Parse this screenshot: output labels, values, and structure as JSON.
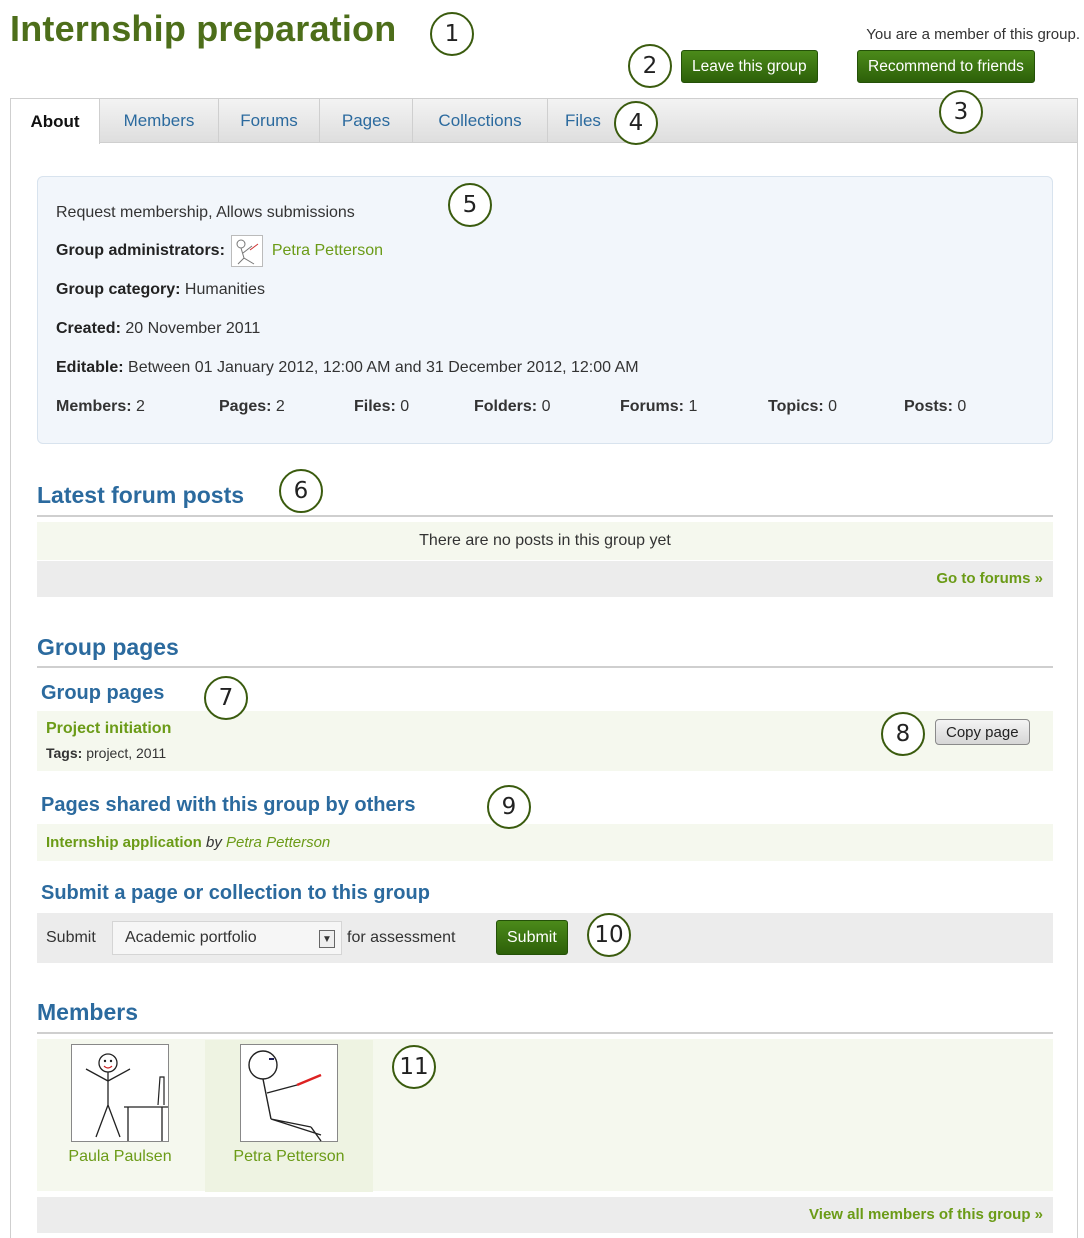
{
  "header": {
    "title": "Internship preparation",
    "membership_note": "You are a member of this group.",
    "leave_label": "Leave this group",
    "recommend_label": "Recommend to friends"
  },
  "tabs": [
    {
      "label": "About",
      "active": true
    },
    {
      "label": "Members"
    },
    {
      "label": "Forums"
    },
    {
      "label": "Pages"
    },
    {
      "label": "Collections"
    },
    {
      "label": "Files"
    }
  ],
  "about": {
    "type_line": "Request membership, Allows submissions",
    "admins_label": "Group administrators:",
    "admin_name": "Petra Petterson",
    "category_label": "Group category:",
    "category": "Humanities",
    "created_label": "Created:",
    "created": "20 November 2011",
    "editable_label": "Editable:",
    "editable": "Between 01 January 2012, 12:00 AM and 31 December 2012, 12:00 AM",
    "stats": [
      {
        "label": "Members:",
        "value": "2"
      },
      {
        "label": "Pages:",
        "value": "2"
      },
      {
        "label": "Files:",
        "value": "0"
      },
      {
        "label": "Folders:",
        "value": "0"
      },
      {
        "label": "Forums:",
        "value": "1"
      },
      {
        "label": "Topics:",
        "value": "0"
      },
      {
        "label": "Posts:",
        "value": "0"
      }
    ]
  },
  "forum": {
    "title": "Latest forum posts",
    "empty": "There are no posts in this group yet",
    "link": "Go to forums »"
  },
  "group_pages": {
    "title": "Group pages",
    "subtitle": "Group pages",
    "page_title": "Project initiation",
    "tags_label": "Tags:",
    "tags": "project, 2011",
    "copy_label": "Copy page",
    "shared_title": "Pages shared with this group by others",
    "shared_page": "Internship application",
    "shared_by": "by",
    "shared_author": "Petra Petterson",
    "submit_title": "Submit a page or collection to this group",
    "submit_prefix": "Submit",
    "submit_selected": "Academic portfolio",
    "submit_suffix": "for assessment",
    "submit_label": "Submit"
  },
  "members": {
    "title": "Members",
    "list": [
      {
        "name": "Paula Paulsen"
      },
      {
        "name": "Petra Petterson"
      }
    ],
    "link": "View all members of this group »"
  },
  "callouts": [
    "1",
    "2",
    "3",
    "4",
    "5",
    "6",
    "7",
    "8",
    "9",
    "10",
    "11"
  ],
  "colors": {
    "title_green": "#4d6e1a",
    "link_blue": "#2b6a9e",
    "link_green": "#6b9b17",
    "button_green": "#2d6009"
  }
}
